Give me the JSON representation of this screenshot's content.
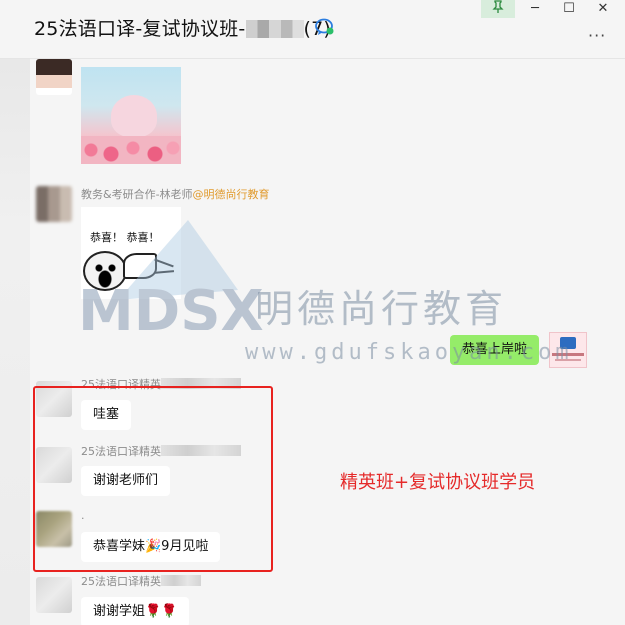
{
  "window": {
    "title_prefix": "25法语口译-复试协议班-",
    "title_suffix": "(7)",
    "pin_icon": "pin-icon",
    "min_label": "─",
    "max_label": "☐",
    "close_label": "✕",
    "more_label": "···"
  },
  "messages": [
    {
      "type": "image",
      "description_icon": "photo"
    },
    {
      "sender": "教务&考研合作-林老师",
      "mention": "@明德尚行教育",
      "sticker_caption": "恭喜！ 恭喜！"
    },
    {
      "type": "outgoing",
      "text": "恭喜上岸啦"
    },
    {
      "sender": "25法语口译精英",
      "text": "哇塞"
    },
    {
      "sender": "25法语口译精英",
      "text": "谢谢老师们"
    },
    {
      "sender": ".",
      "text": "恭喜学妹🎉9月见啦"
    },
    {
      "sender": "25法语口译精英",
      "text": "谢谢学姐🌹🌹"
    }
  ],
  "annotation": "精英班+复试协议班学员",
  "watermark": {
    "brand_cn": "明德尚行教育",
    "brand_logo": "MDSX",
    "url": "www.gdufskaoyan.com"
  },
  "colors": {
    "accent_red": "#e52a2a",
    "bubble_green": "#95ec69",
    "mention": "#e19b2e"
  }
}
